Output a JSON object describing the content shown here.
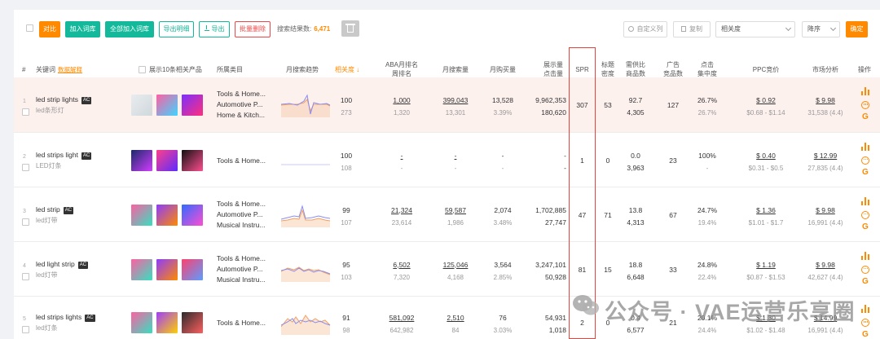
{
  "toolbar": {
    "btn_compare": "对比",
    "btn_add": "加入词库",
    "btn_add_all": "全部加入词库",
    "btn_export_detail": "导出明细",
    "btn_export": "导出",
    "btn_batch_delete": "批量删除",
    "result_label": "搜索结果数:",
    "result_count": "6,471",
    "btn_custom_cols": "自定义列",
    "btn_copy": "复制",
    "relevance_select": "相关度",
    "sort_select": "降序",
    "btn_confirm": "确定"
  },
  "header": {
    "index": "#",
    "keyword": "关键词",
    "data_explain": "数据解释",
    "show_products": "展示10条相关产品",
    "category": "所属类目",
    "trend": "月搜索趋势",
    "relevance": "相关度",
    "aba_rank_1": "ABA月排名",
    "aba_rank_2": "周排名",
    "monthly_search": "月搜索量",
    "monthly_purchase": "月购买量",
    "impression_1": "展示量",
    "impression_2": "点击量",
    "spr": "SPR",
    "title_density_1": "标题",
    "title_density_2": "密度",
    "supply_demand_1": "需供比",
    "supply_demand_2": "商品数",
    "ad_1": "广告",
    "ad_2": "竞品数",
    "click_conc_1": "点击",
    "click_conc_2": "集中度",
    "ppc": "PPC竞价",
    "market": "市场分析",
    "ops": "操作"
  },
  "rows": [
    {
      "idx": "1",
      "kw": "led strip lights",
      "ac": "AC",
      "kw_cn": "led条形灯",
      "cat": [
        "Tools & Home...",
        "Automotive P...",
        "Home & Kitch..."
      ],
      "rel": "100",
      "rel_sub": "273",
      "aba": "1,000",
      "aba_sub": "1,320",
      "search": "399,043",
      "search_sub": "13,301",
      "purchase": "13,528",
      "purchase_sub": "3.39%",
      "imp": "9,962,353",
      "click": "180,620",
      "spr": "307",
      "density": "53",
      "sd": "92.7",
      "sd_sub": "4,305",
      "ad": "127",
      "cc": "26.7%",
      "cc_sub": "26.7%",
      "ppc": "$ 0.92",
      "ppc_sub": "$0.68 - $1.14",
      "mkt": "$ 9.98",
      "mkt_sub": "31,538 (4.4)"
    },
    {
      "idx": "2",
      "kw": "led strips light",
      "ac": "AC",
      "kw_cn": "LED灯条",
      "cat": [
        "Tools & Home..."
      ],
      "rel": "100",
      "rel_sub": "108",
      "aba": "-",
      "aba_sub": "-",
      "search": "-",
      "search_sub": "-",
      "purchase": "-",
      "purchase_sub": "-",
      "imp": "-",
      "click": "-",
      "spr": "1",
      "density": "0",
      "sd": "0.0",
      "sd_sub": "3,963",
      "ad": "23",
      "cc": "100%",
      "cc_sub": "-",
      "ppc": "$ 0.40",
      "ppc_sub": "$0.31 - $0.5",
      "mkt": "$ 12.99",
      "mkt_sub": "27,835 (4.4)"
    },
    {
      "idx": "3",
      "kw": "led strip",
      "ac": "AC",
      "kw_cn": "led灯带",
      "cat": [
        "Tools & Home...",
        "Automotive P...",
        "Musical Instru..."
      ],
      "rel": "99",
      "rel_sub": "107",
      "aba": "21,324",
      "aba_sub": "23,614",
      "search": "59,587",
      "search_sub": "1,986",
      "purchase": "2,074",
      "purchase_sub": "3.48%",
      "imp": "1,702,885",
      "click": "27,747",
      "spr": "47",
      "density": "71",
      "sd": "13.8",
      "sd_sub": "4,313",
      "ad": "67",
      "cc": "24.7%",
      "cc_sub": "19.4%",
      "ppc": "$ 1.36",
      "ppc_sub": "$1.01 - $1.7",
      "mkt": "$ 9.98",
      "mkt_sub": "16,991 (4.4)"
    },
    {
      "idx": "4",
      "kw": "led light strip",
      "ac": "AC",
      "kw_cn": "led灯带",
      "cat": [
        "Tools & Home...",
        "Automotive P...",
        "Musical Instru..."
      ],
      "rel": "95",
      "rel_sub": "103",
      "aba": "6,502",
      "aba_sub": "7,320",
      "search": "125,046",
      "search_sub": "4,168",
      "purchase": "3,564",
      "purchase_sub": "2.85%",
      "imp": "3,247,101",
      "click": "50,928",
      "spr": "81",
      "density": "15",
      "sd": "18.8",
      "sd_sub": "6,648",
      "ad": "33",
      "cc": "24.8%",
      "cc_sub": "22.4%",
      "ppc": "$ 1.19",
      "ppc_sub": "$0.87 - $1.53",
      "mkt": "$ 9.98",
      "mkt_sub": "42,627 (4.4)"
    },
    {
      "idx": "5",
      "kw": "led strips lights",
      "ac": "AC",
      "kw_cn": "led灯条",
      "cat": [
        "Tools & Home..."
      ],
      "rel": "91",
      "rel_sub": "98",
      "aba": "581,092",
      "aba_sub": "642,982",
      "search": "2,510",
      "search_sub": "84",
      "purchase": "76",
      "purchase_sub": "3.03%",
      "imp": "54,931",
      "click": "1,018",
      "spr": "2",
      "density": "0",
      "sd": "0.4",
      "sd_sub": "6,577",
      "ad": "21",
      "cc": "20.1%",
      "cc_sub": "24.4%",
      "ppc": "$ 1.30",
      "ppc_sub": "$1.02 - $1.48",
      "mkt": "$ 14.99",
      "mkt_sub": "16,991 (4.4)"
    }
  ],
  "watermark": "公众号 · VAE运营乐享圈",
  "colors": {
    "accent": "#ff8a00",
    "green": "#13b99a",
    "red": "#f04848",
    "highlight": "#fdf1ee"
  }
}
